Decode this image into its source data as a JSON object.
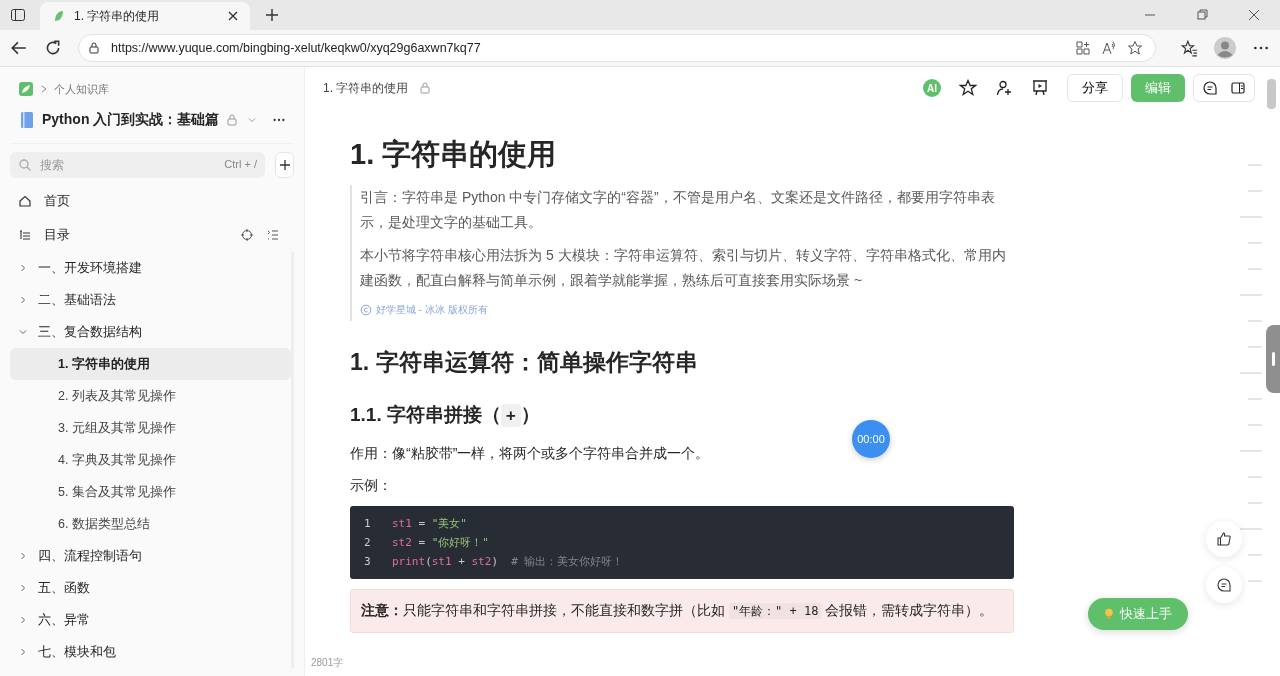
{
  "browser": {
    "tab_title": "1. 字符串的使用",
    "url": "https://www.yuque.com/bingbing-xelut/keqkw0/xyq29g6axwn7kq77"
  },
  "sidebar": {
    "breadcrumb": "个人知识库",
    "book_title": "Python 入门到实战：基础篇",
    "search": {
      "placeholder": "搜索",
      "shortcut": "Ctrl + /"
    },
    "nav": [
      {
        "kind": "home",
        "label": "首页"
      },
      {
        "kind": "toc",
        "label": "目录"
      }
    ],
    "tree": [
      {
        "label": "一、开发环境搭建",
        "expanded": false,
        "selected": false
      },
      {
        "label": "二、基础语法",
        "expanded": false,
        "selected": false
      },
      {
        "label": "三、复合数据结构",
        "expanded": true,
        "selected": false,
        "children": [
          {
            "label": "1. 字符串的使用",
            "selected": true
          },
          {
            "label": "2. 列表及其常见操作",
            "selected": false
          },
          {
            "label": "3. 元组及其常见操作",
            "selected": false
          },
          {
            "label": "4. 字典及其常见操作",
            "selected": false
          },
          {
            "label": "5. 集合及其常见操作",
            "selected": false
          },
          {
            "label": "6. 数据类型总结",
            "selected": false
          }
        ]
      },
      {
        "label": "四、流程控制语句",
        "expanded": false,
        "selected": false
      },
      {
        "label": "五、函数",
        "expanded": false,
        "selected": false
      },
      {
        "label": "六、异常",
        "expanded": false,
        "selected": false
      },
      {
        "label": "七、模块和包",
        "expanded": false,
        "selected": false
      }
    ]
  },
  "header": {
    "doc_title": "1. 字符串的使用",
    "ai_badge": "AI",
    "share_button": "分享",
    "edit_button": "编辑"
  },
  "document": {
    "title": "1. 字符串的使用",
    "quote": [
      "引言：字符串是 Python 中专门存储文字的“容器”，不管是用户名、文案还是文件路径，都要用字符串表示，是处理文字的基础工具。",
      "本小节将字符串核心用法拆为 5 大模块：字符串运算符、索引与切片、转义字符、字符串格式化、常用内建函数，配直白解释与简单示例，跟着学就能掌握，熟练后可直接套用实际场景 ~"
    ],
    "copyright": "好学星城 - 冰冰 版权所有",
    "h2": "1. 字符串运算符：简单操作字符串",
    "h3": {
      "text": "1.1. 字符串拼接（",
      "code": "+",
      "after": "）"
    },
    "paragraphs": [
      "作用：像“粘胶带”一样，将两个或多个字符串合并成一个。",
      "示例："
    ],
    "code_lines": [
      {
        "number": "1",
        "tokens": [
          {
            "kind": "var",
            "text": "st1"
          },
          {
            "kind": "op",
            "text": " = "
          },
          {
            "kind": "str",
            "text": "\"美女\""
          }
        ]
      },
      {
        "number": "2",
        "tokens": [
          {
            "kind": "var",
            "text": "st2"
          },
          {
            "kind": "op",
            "text": " = "
          },
          {
            "kind": "str",
            "text": "\"你好呀！\""
          }
        ]
      },
      {
        "number": "3",
        "tokens": [
          {
            "kind": "fn",
            "text": "print"
          },
          {
            "kind": "op",
            "text": "("
          },
          {
            "kind": "var",
            "text": "st1"
          },
          {
            "kind": "op",
            "text": " + "
          },
          {
            "kind": "var",
            "text": "st2"
          },
          {
            "kind": "op",
            "text": ")  "
          },
          {
            "kind": "comment",
            "text": "# 输出：美女你好呀！"
          }
        ]
      }
    ],
    "note": {
      "before": "**注意：**只能字符串和字符串拼接，不能直接和数字拼（比如 ",
      "code": "\"年龄：\" + 18",
      "after": " 会报错，需转成字符串）。"
    },
    "word_count": "2801字"
  },
  "timer": "00:00",
  "quick_start_button": "快速上手"
}
